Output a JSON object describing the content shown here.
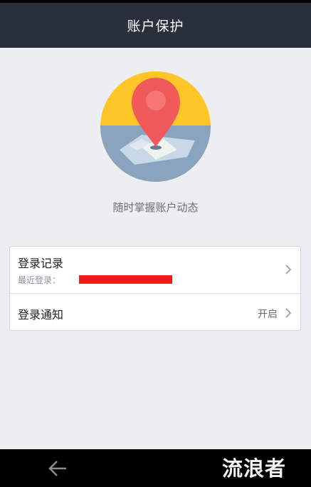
{
  "header": {
    "title": "账户保护"
  },
  "hero": {
    "illustration": "location-pin-icon",
    "subtitle": "随时掌握账户动态"
  },
  "settings": [
    {
      "label": "登录记录",
      "sub_label": "最近登录：",
      "sub_value_redacted": true
    },
    {
      "label": "登录通知",
      "status": "开启"
    }
  ],
  "nav": {
    "back_icon": "back-arrow-icon"
  },
  "watermark": {
    "text": "流浪者"
  },
  "colors": {
    "header_bg": "#2a2f3c",
    "page_bg": "#edeef2",
    "accent_yellow": "#ffc627",
    "accent_blue": "#8aa4c0",
    "pin_red": "#f15a5a",
    "redaction": "#f01c1c"
  }
}
